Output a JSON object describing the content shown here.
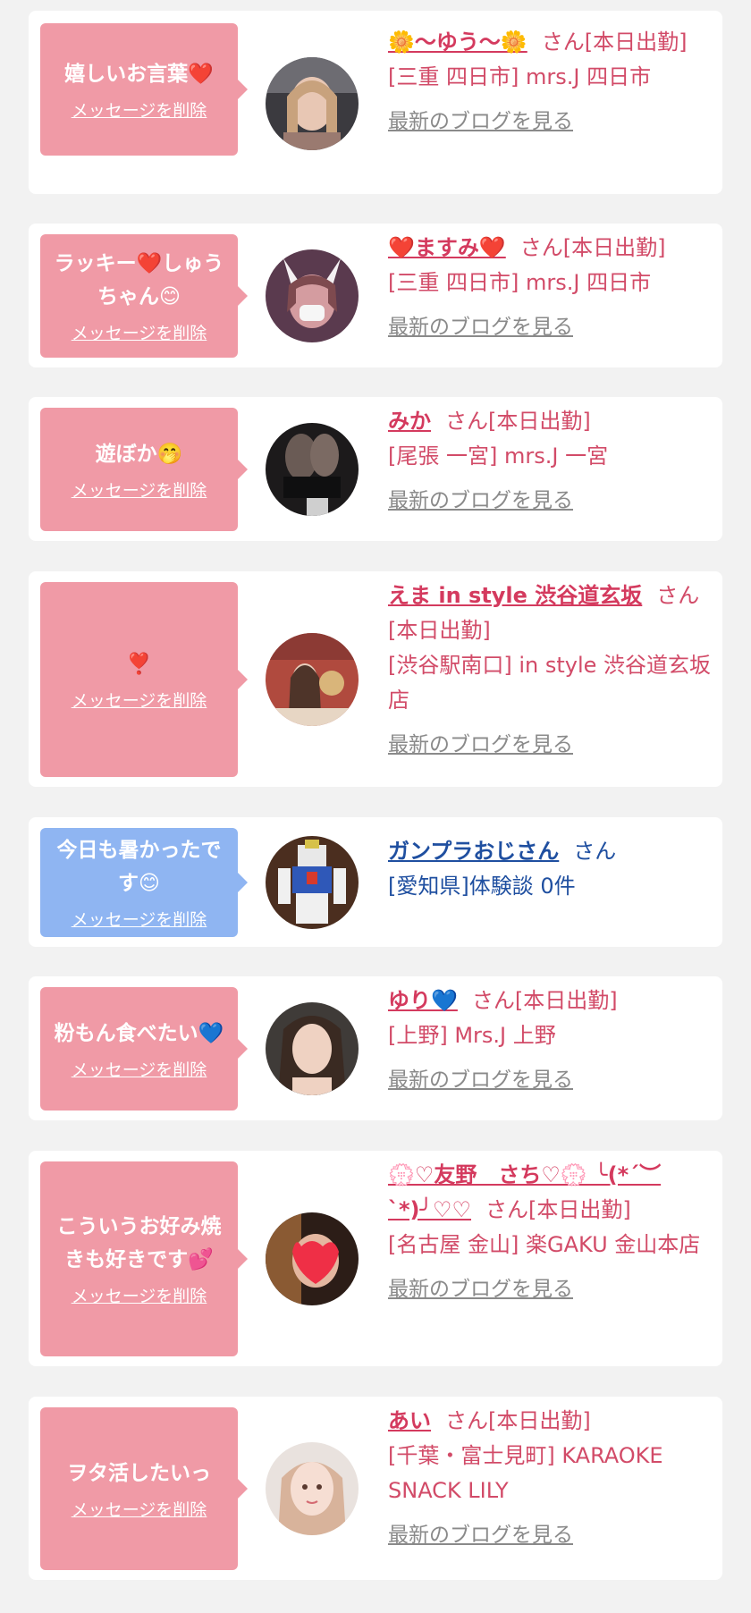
{
  "delete_label": "メッセージを削除",
  "blog_label": "最新のブログを見る",
  "colors": {
    "pink_bubble": "#f09aa6",
    "blue_bubble": "#8fb5f2",
    "name_pink": "#d43a5e",
    "name_blue": "#1f4fa0",
    "link_gray": "#8a8a8a"
  },
  "cards": [
    {
      "message": "嬉しいお言葉❤️",
      "name": "🌼～ゆう～🌼",
      "suffix": "さん[本日出勤]",
      "shop": "[三重 四日市] mrs.J 四日市"
    },
    {
      "message": "ラッキー❤️しゅうちゃん😊",
      "name": "❤️ますみ❤️",
      "suffix": "さん[本日出勤]",
      "shop": "[三重 四日市] mrs.J 四日市"
    },
    {
      "message": "遊ぼか🤭",
      "name": "みか",
      "suffix": "さん[本日出勤]",
      "shop": "[尾張 一宮] mrs.J 一宮"
    },
    {
      "message": "❣️",
      "name": "えま in style 渋谷道玄坂",
      "suffix": "さん[本日出勤]",
      "shop": "[渋谷駅南口] in style 渋谷道玄坂店"
    },
    {
      "message": "今日も暑かったです😊",
      "name": "ガンプラおじさん",
      "suffix": "さん",
      "shop": "[愛知県]体験談 0件"
    },
    {
      "message": "粉もん食べたい💙",
      "name": "ゆり💙",
      "suffix": "さん[本日出勤]",
      "shop": "[上野] Mrs.J 上野"
    },
    {
      "message": "こういうお好み焼きも好きです💕",
      "name": "💮♡友野　さち♡💮 ╰(*´︶`*)╯♡♡",
      "suffix": "さん[本日出勤]",
      "shop": "[名古屋 金山] 楽GAKU 金山本店"
    },
    {
      "message": "ヲタ活したいっ",
      "name": "あい",
      "suffix": "さん[本日出勤]",
      "shop": "[千葉・富士見町] KARAOKE SNACK LILY"
    }
  ]
}
